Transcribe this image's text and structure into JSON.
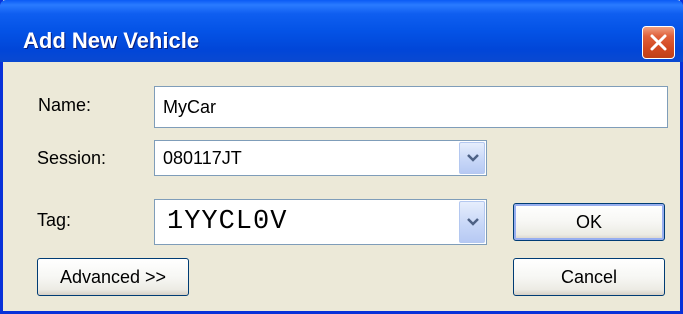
{
  "window": {
    "title": "Add New Vehicle"
  },
  "form": {
    "name_label": "Name:",
    "name_value": "MyCar",
    "session_label": "Session:",
    "session_value": "080117JT",
    "tag_label": "Tag:",
    "tag_value": "1YYCL0V"
  },
  "buttons": {
    "ok": "OK",
    "cancel": "Cancel",
    "advanced": "Advanced >>"
  },
  "icons": {
    "close": "close-icon",
    "dropdown": "chevron-down-icon"
  },
  "colors": {
    "titlebar": "#0453e6",
    "close_button": "#d14820",
    "dialog_background": "#ece9d8",
    "field_border": "#7f9db9"
  }
}
